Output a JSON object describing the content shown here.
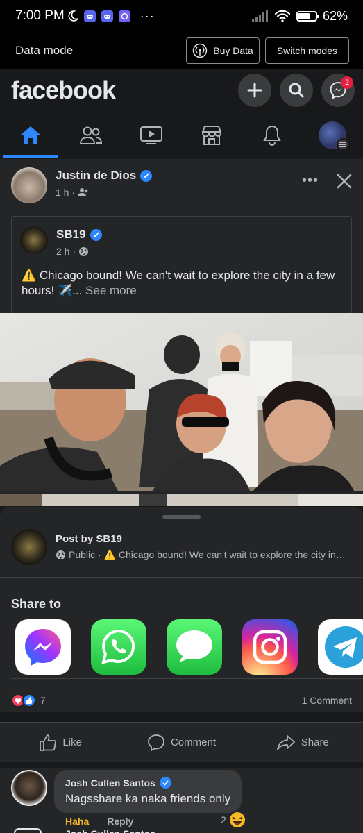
{
  "status_bar": {
    "time": "7:00 PM",
    "battery_pct": "62%",
    "battery_level": 0.62,
    "dots": "···"
  },
  "data_mode": {
    "title": "Data mode",
    "buy_data_label": "Buy Data",
    "switch_label": "Switch modes"
  },
  "header": {
    "logo": "facebook",
    "messenger_badge": "2"
  },
  "nav": {
    "tabs": [
      "home",
      "friends",
      "watch",
      "marketplace",
      "notifications",
      "menu"
    ],
    "active": "home"
  },
  "post": {
    "author": "Justin de Dios",
    "time": "1 h",
    "shared": {
      "author": "SB19",
      "time": "2 h",
      "text": "⚠️ Chicago bound! We can't wait to explore the city in a few hours! ✈️...",
      "see_more": "See more"
    }
  },
  "share_sheet": {
    "post_title": "Post by SB19",
    "post_sub": "Public · ⚠️ Chicago bound! We can't wait to explore the city in a ...",
    "share_to_label": "Share to",
    "apps": [
      "messenger",
      "whatsapp",
      "messages",
      "instagram",
      "telegram"
    ]
  },
  "reactions": {
    "count": "7",
    "comments": "1 Comment"
  },
  "actions": {
    "like": "Like",
    "comment": "Comment",
    "share": "Share"
  },
  "comment": {
    "author": "Josh Cullen Santos",
    "text": "Nagsshare ka naka friends only",
    "reaction_label": "Haha",
    "reply_label": "Reply",
    "reaction_count": "2",
    "next_author": "Josh Cullen Santos"
  },
  "colors": {
    "accent": "#2d88ff",
    "background": "#18191a",
    "surface": "#242526",
    "badge": "#e41e3f"
  }
}
